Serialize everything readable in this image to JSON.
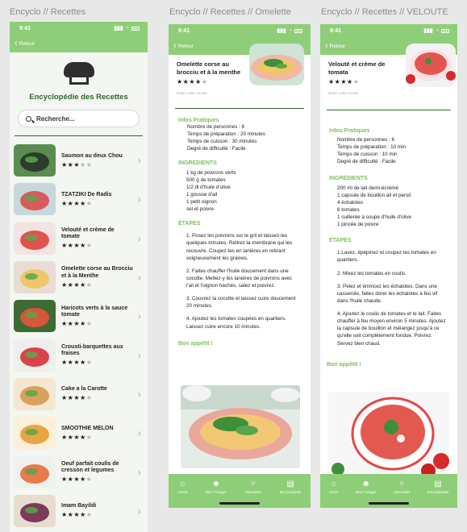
{
  "frames": {
    "f1": "Encyclo // Recettes",
    "f2": "Encyclo // Recettes // Omelette",
    "f3": "Encyclo // Recettes // VELOUTE"
  },
  "status": {
    "time": "9:41"
  },
  "back_label": "Retour",
  "home": {
    "title": "Encyclopédie des Recettes",
    "search_placeholder": "Recherche...",
    "recipes": [
      {
        "name": "Saumon au deux Chou",
        "rating": 3
      },
      {
        "name": "TZATZIKI De Radis",
        "rating": 4
      },
      {
        "name": "Velouté et crème de tomate",
        "rating": 4
      },
      {
        "name": "Omelette corse au Brocciu et à la Menthe",
        "rating": 4
      },
      {
        "name": "Haricots verts à la sauce tomate",
        "rating": 4
      },
      {
        "name": "Crousti-barquettes aux fraises",
        "rating": 4
      },
      {
        "name": "Cake a la Carotte",
        "rating": 4
      },
      {
        "name": "SMOOTHIE MELON",
        "rating": 4
      },
      {
        "name": "Oeuf parfait coulis de cresson et legumes",
        "rating": 4
      },
      {
        "name": "Imam Bayildi",
        "rating": 4
      }
    ]
  },
  "omelette": {
    "title": "Omelette corse au brocciu et à la menthe",
    "rating": 4,
    "note": "Notez cette recette",
    "infos_title": "Infos Pratiques",
    "infos": [
      "Nombre de personnes : 6",
      "Temps de préparation : 20 minutes",
      "Temps de cuisson : 30 minutes",
      "Degré de difficulté : Facile"
    ],
    "ingredients_title": "INGREDIENTS",
    "ingredients": [
      "1 kg de poivrons verts",
      "500 g de tomates",
      "1/2 dl d'huile d'olive",
      "1 gousse d'ail",
      "1 petit oignon",
      "sel et poivre"
    ],
    "steps_title": "ÉTAPES",
    "steps": [
      "1. Posez les poivrons sur le gril et laissez-les quelques minutes. Retirez la membrane qui les recouvre. Coupez-les en lanières en retirant soigneusement les graines.",
      "2. Faites chauffer l'huile doucement dans une cocotte. Mettez-y les lanières de poivrons avec l'ail et l'oignon hachés, salez et poivrez.",
      "3. Couvrez la cocotte et laissez cuire doucement 20 minutes.",
      "4. Ajoutez les tomates coupées en quartiers. Laissez cuire encore 10 minutes."
    ],
    "bon": "Bon appétit !"
  },
  "veloute": {
    "title": "Velouté et crème de tomata",
    "rating": 4,
    "note": "Notez cette recette",
    "infos_title": "Infos Pratiques",
    "infos": [
      "Nombre de personnes : 6",
      "Temps de préparation : 10 min",
      "Temps de cuisson : 10 min",
      "Degré de difficulté : Facile"
    ],
    "ingredients_title": "INGREDIENTS",
    "ingredients": [
      "200 ml de lait demi-écrémé",
      "1 capsule de bouillon ail et persil",
      "4 échalotes",
      "6 tomates",
      "1 cuillerée à soupe d'huile d'olive",
      "1 pincée de poivre"
    ],
    "steps_title": "ÉTAPES",
    "steps": [
      "1.Lavez, épépinez et coupez les tomates en quartiers.",
      "2. Mixez les tomates en coulis.",
      "3. Pelez et émincez les échalotes. Dans une casserole, faites dorer les échalotes à feu vif dans l'huile chaude.",
      "4. Ajoutez le coulis de tomates et le lait. Faites chauffer à feu moyen environ 5 minutes. Ajoutez la capsule de bouillon et mélangez jusqu'à ce qu'elle soit complètement fondue. Poivrez. Servez bien chaud."
    ],
    "bon": "Bon appétit !"
  },
  "nav": [
    {
      "label": "Home",
      "icon": "house-icon"
    },
    {
      "label": "Mon Potager",
      "icon": "gardener-icon"
    },
    {
      "label": "Ustensiles",
      "icon": "utensils-icon"
    },
    {
      "label": "Encyclopédie",
      "icon": "book-icon"
    }
  ],
  "colors": {
    "brand_green": "#8fce78",
    "dark_green": "#2d6a27",
    "section_green": "#7cbf5f"
  }
}
